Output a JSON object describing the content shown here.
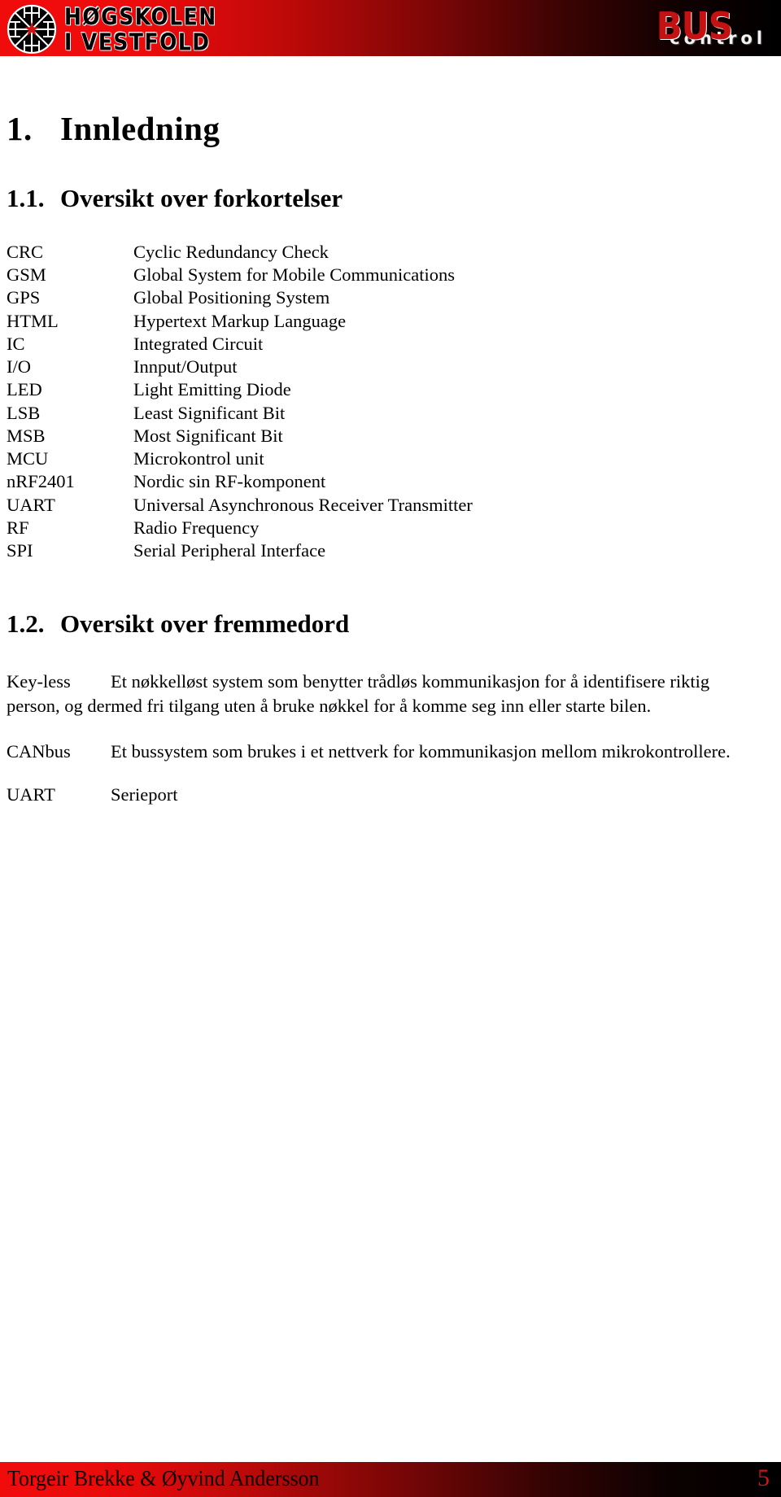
{
  "header": {
    "institution_line_1": "HØGSKOLEN",
    "institution_line_2": "I VESTFOLD",
    "project_logo_primary": "BUS",
    "project_logo_secondary": "control",
    "colors": {
      "banner_red": "#f10c0c",
      "banner_black": "#000000",
      "bus_red": "#c41212",
      "control_white": "#f2f2f2"
    }
  },
  "document": {
    "chapter": {
      "number": "1.",
      "title": "Innledning"
    },
    "sections": [
      {
        "number": "1.1.",
        "title": "Oversikt over forkortelser"
      },
      {
        "number": "1.2.",
        "title": "Oversikt over fremmedord"
      }
    ],
    "abbreviations": [
      {
        "key": "CRC",
        "value": "Cyclic Redundancy Check"
      },
      {
        "key": "GSM",
        "value": "Global System for Mobile Communications"
      },
      {
        "key": "GPS",
        "value": "Global Positioning System"
      },
      {
        "key": "HTML",
        "value": "Hypertext Markup Language"
      },
      {
        "key": "IC",
        "value": "Integrated Circuit"
      },
      {
        "key": "I/O",
        "value": "Innput/Output"
      },
      {
        "key": "LED",
        "value": "Light Emitting Diode"
      },
      {
        "key": "LSB",
        "value": "Least Significant Bit"
      },
      {
        "key": "MSB",
        "value": "Most Significant Bit"
      },
      {
        "key": "MCU",
        "value": "Microkontrol unit"
      },
      {
        "key": "nRF2401",
        "value": "Nordic sin RF-komponent"
      },
      {
        "key": "UART",
        "value": "Universal Asynchronous Receiver Transmitter"
      },
      {
        "key": "RF",
        "value": "Radio Frequency"
      },
      {
        "key": "SPI",
        "value": "Serial Peripheral Interface"
      }
    ],
    "glossary": [
      {
        "term": "Key-less",
        "definition": "Et nøkkelløst system som benytter trådløs kommunikasjon for å identifisere riktig person, og dermed fri tilgang uten å bruke nøkkel for å komme seg inn eller starte bilen."
      },
      {
        "term": "CANbus",
        "definition": "Et bussystem som brukes i et nettverk for kommunikasjon mellom mikrokontrollere."
      },
      {
        "term": "UART",
        "definition": "Serieport"
      }
    ]
  },
  "footer": {
    "authors": "Torgeir Brekke & Øyvind Andersson",
    "page_number": "5"
  }
}
